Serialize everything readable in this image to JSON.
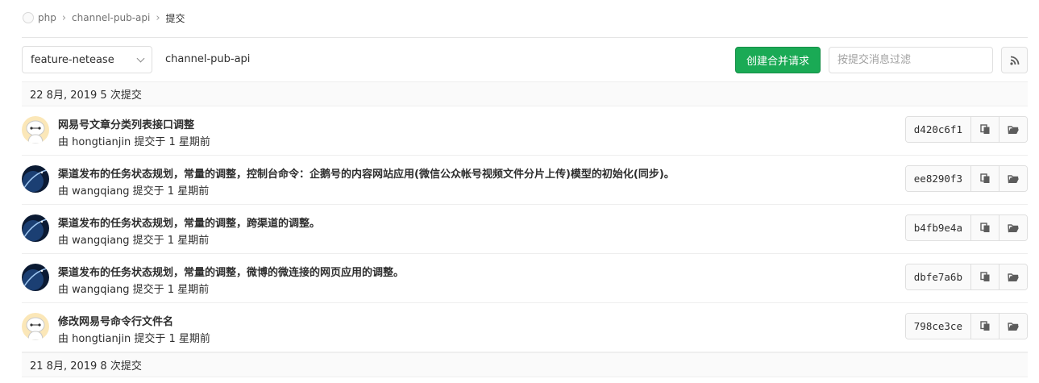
{
  "breadcrumb": {
    "group": "php",
    "project": "channel-pub-api",
    "current": "提交",
    "separator": "›"
  },
  "toolbar": {
    "branch": "feature-netease",
    "path": "channel-pub-api",
    "merge_button": "创建合并请求",
    "filter_placeholder": "按提交消息过滤"
  },
  "days": [
    {
      "header": "22 8月, 2019 5 次提交",
      "commits": [
        {
          "title": "网易号文章分类列表接口调整",
          "meta": "由 hongtianjin 提交于 1 星期前",
          "sha": "d420c6f1",
          "avatar": "robot"
        },
        {
          "title": "渠道发布的任务状态规划，常量的调整，控制台命令：企鹅号的内容网站应用(微信公众帐号视频文件分片上传)模型的初始化(同步)。",
          "meta": "由 wangqiang 提交于 1 星期前",
          "sha": "ee8290f3",
          "avatar": "space"
        },
        {
          "title": "渠道发布的任务状态规划，常量的调整，跨渠道的调整。",
          "meta": "由 wangqiang 提交于 1 星期前",
          "sha": "b4fb9e4a",
          "avatar": "space"
        },
        {
          "title": "渠道发布的任务状态规划，常量的调整，微博的微连接的网页应用的调整。",
          "meta": "由 wangqiang 提交于 1 星期前",
          "sha": "dbfe7a6b",
          "avatar": "space"
        },
        {
          "title": "修改网易号命令行文件名",
          "meta": "由 hongtianjin 提交于 1 星期前",
          "sha": "798ce3ce",
          "avatar": "robot"
        }
      ]
    },
    {
      "header": "21 8月, 2019 8 次提交",
      "commits": []
    }
  ],
  "colors": {
    "primary_green": "#1aaa55",
    "text": "#2e2e2e",
    "border": "#dfdfdf",
    "header_bg": "#fafafa"
  }
}
